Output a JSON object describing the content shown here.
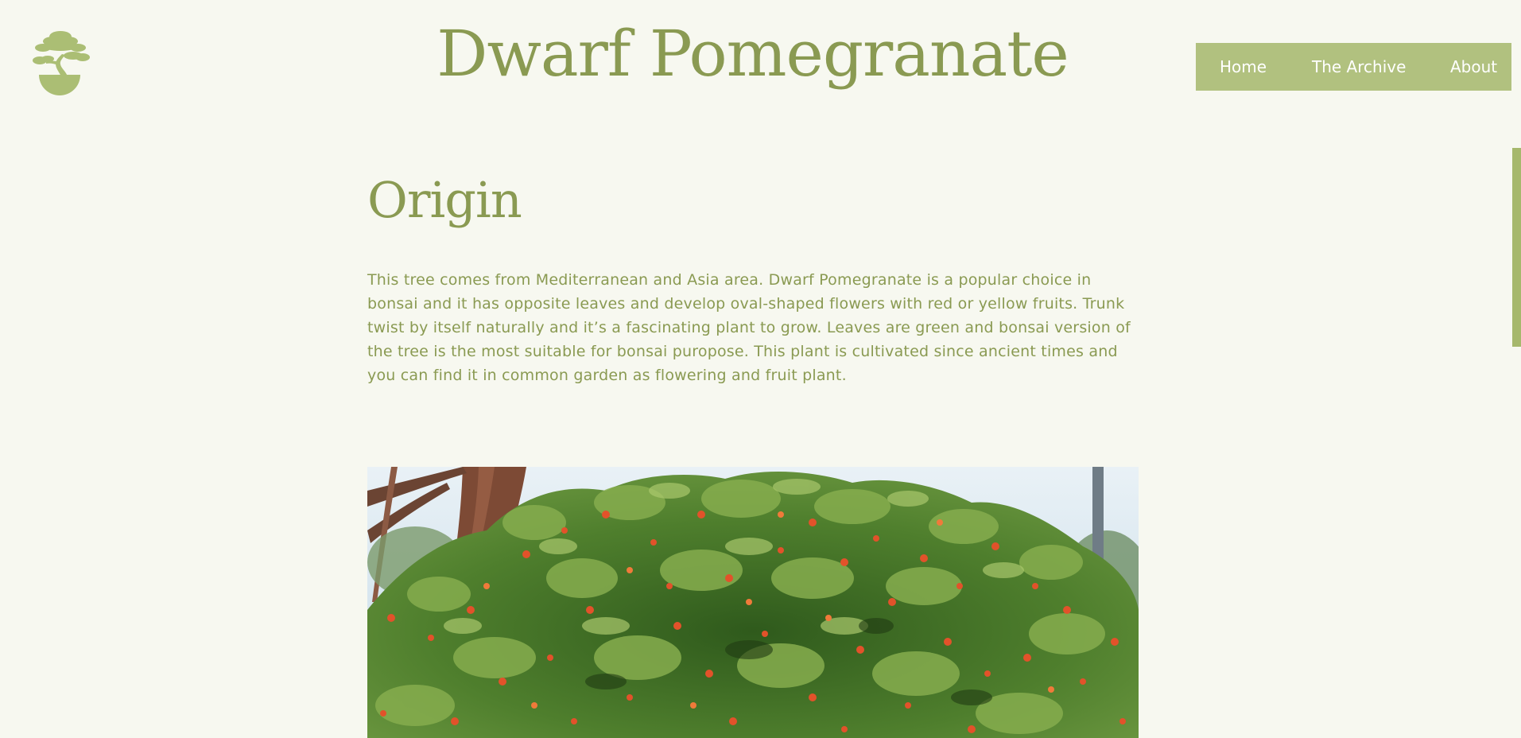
{
  "site": {
    "title": "Dwarf Pomegranate",
    "logo_icon": "bonsai-tree-icon"
  },
  "nav": {
    "items": [
      {
        "label": "Home"
      },
      {
        "label": "The Archive"
      },
      {
        "label": "About"
      }
    ]
  },
  "section": {
    "heading": "Origin",
    "body": "This tree comes from Mediterranean and Asia area. Dwarf Pomegranate is a popular choice in bonsai and it has opposite leaves and develop oval-shaped flowers with red or yellow fruits. Trunk twist by itself naturally and it’s a fascinating plant to grow. Leaves are green and bonsai version of the tree is the most suitable for bonsai puropose. This plant is cultivated since ancient times and you can find it in common garden as flowering and fruit plant."
  },
  "colors": {
    "background": "#f7f8f0",
    "accent": "#8a9a52",
    "nav_bg": "#b1c17f",
    "nav_text": "#ffffff"
  }
}
